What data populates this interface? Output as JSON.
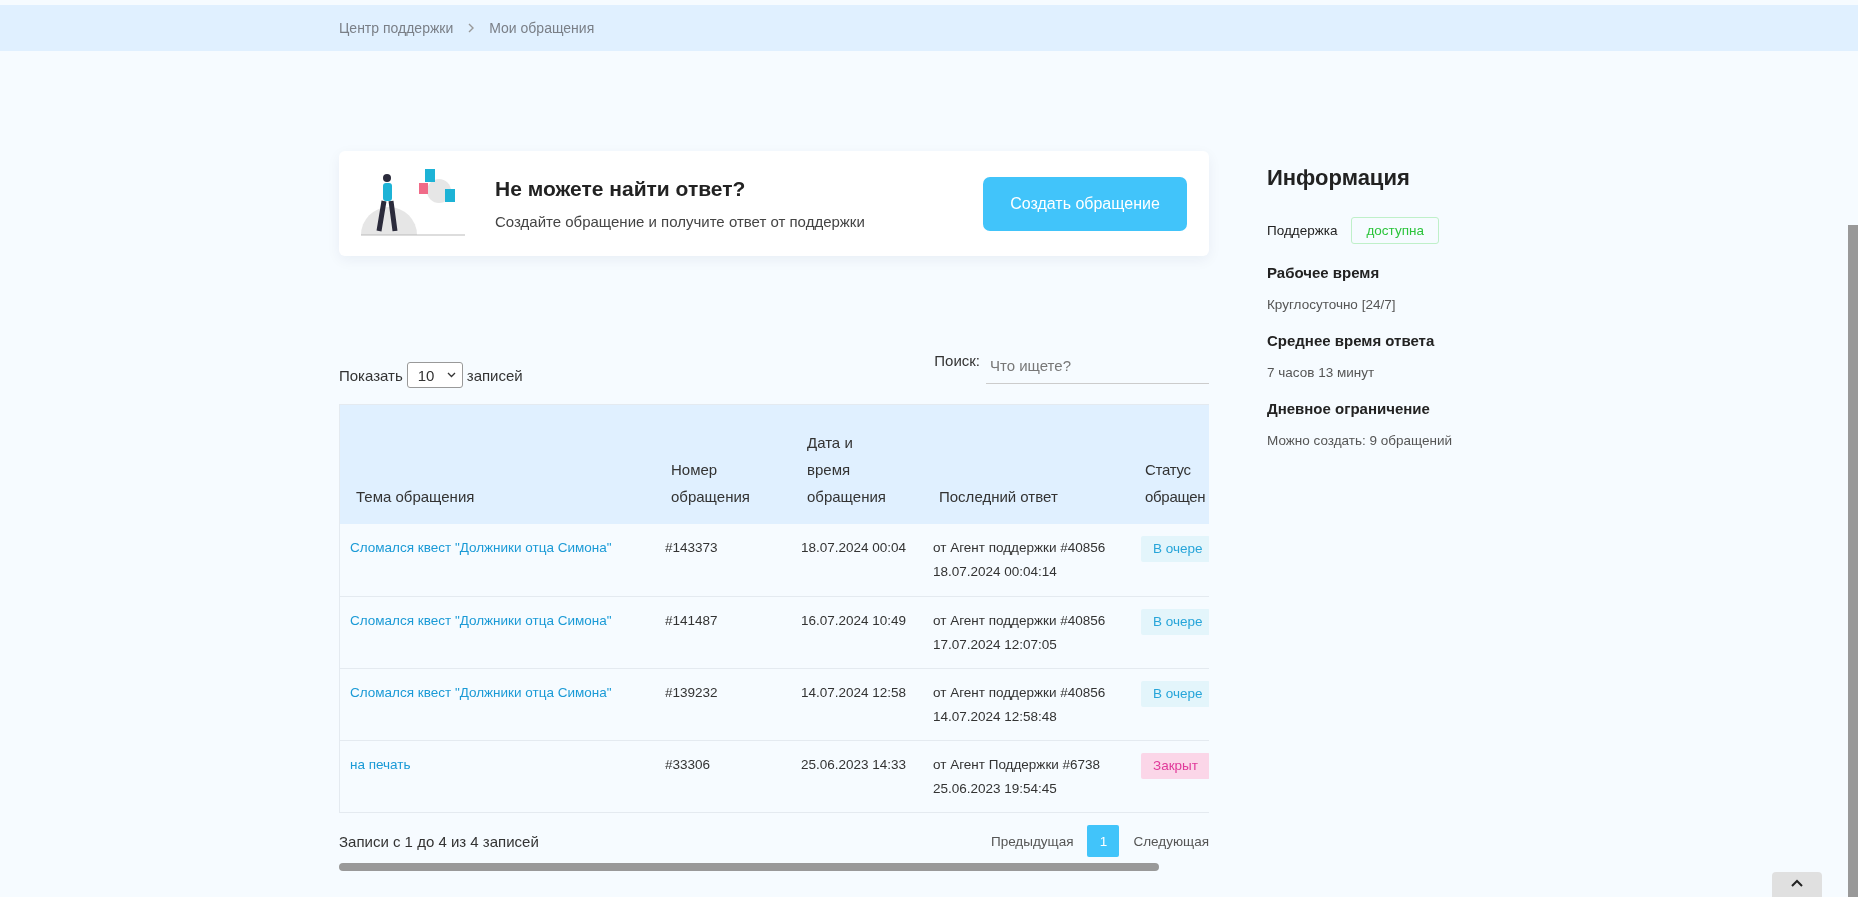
{
  "breadcrumbs": [
    {
      "label": "Центр поддержки"
    },
    {
      "label": "Мои обращения"
    }
  ],
  "banner": {
    "title": "Не можете найти ответ?",
    "subtitle": "Создайте обращение и получите ответ от поддержки",
    "button": "Создать обращение"
  },
  "table_controls": {
    "show_label": "Показать",
    "page_size": "10",
    "entries_label": "записей",
    "search_label": "Поиск:",
    "search_placeholder": "Что ищете?"
  },
  "table": {
    "columns": [
      [
        "Тема обращения"
      ],
      [
        "Номер",
        "обращения"
      ],
      [
        "Дата и",
        "время",
        "обращения"
      ],
      [
        "Последний ответ"
      ],
      [
        "Статус",
        "обращен"
      ]
    ],
    "rows": [
      {
        "topic": "Сломался квест \"Должники отца Симона\"",
        "number": "#143373",
        "date": "18.07.2024 00:04",
        "reply_by": "от Агент поддержки #40856",
        "reply_time": "18.07.2024 00:04:14",
        "status": "В очере",
        "kind": "queued"
      },
      {
        "topic": "Сломался квест \"Должники отца Симона\"",
        "number": "#141487",
        "date": "16.07.2024 10:49",
        "reply_by": "от Агент поддержки #40856",
        "reply_time": "17.07.2024 12:07:05",
        "status": "В очере",
        "kind": "queued"
      },
      {
        "topic": "Сломался квест \"Должники отца Симона\"",
        "number": "#139232",
        "date": "14.07.2024 12:58",
        "reply_by": "от Агент поддержки #40856",
        "reply_time": "14.07.2024 12:58:48",
        "status": "В очере",
        "kind": "queued"
      },
      {
        "topic": "на печать",
        "number": "#33306",
        "date": "25.06.2023 14:33",
        "reply_by": "от Агент Поддержки #6738",
        "reply_time": "25.06.2023 19:54:45",
        "status": "Закрыт",
        "kind": "closed"
      }
    ]
  },
  "table_footer": {
    "info": "Записи с 1 до 4 из 4 записей",
    "pages": [
      {
        "label": "Предыдущая",
        "kind": "nav"
      },
      {
        "label": "1",
        "kind": "page",
        "selected": true
      },
      {
        "label": "Следующая",
        "kind": "nav"
      }
    ]
  },
  "info": {
    "title": "Информация",
    "support_label": "Поддержка",
    "support_status": "доступна",
    "sections": [
      {
        "title": "Рабочее время",
        "value": "Круглосуточно [24/7]"
      },
      {
        "title": "Среднее время ответа",
        "value": "7 часов 13 минут"
      },
      {
        "title": "Дневное ограничение",
        "value": "Можно создать: 9 обращений"
      }
    ]
  }
}
